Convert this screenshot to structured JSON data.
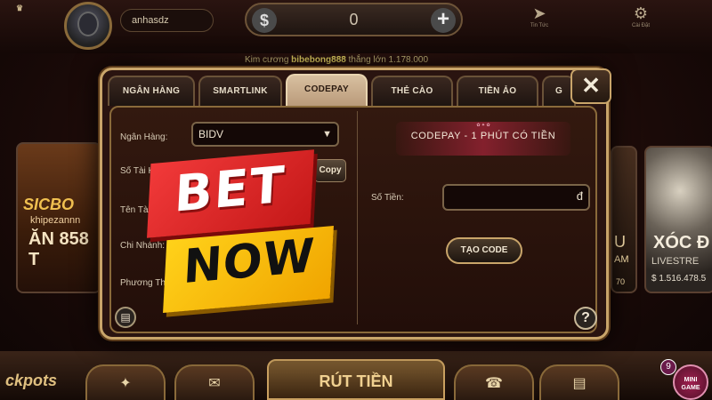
{
  "header": {
    "username": "anhasdz",
    "balance": "0",
    "currency_icon": "dollar-icon",
    "add_icon": "plus-icon",
    "right_icons": [
      {
        "name": "send-icon",
        "label": "Tin Tức"
      },
      {
        "name": "gear-icon",
        "label": "Cài Đặt"
      }
    ]
  },
  "ticker": {
    "prefix": "Kim cương",
    "name": "bibebong888",
    "suffix": "thắng lớn 1.178.000"
  },
  "dialog": {
    "tabs": [
      {
        "label": "NGÂN HÀNG",
        "active": false
      },
      {
        "label": "SMARTLINK",
        "active": false
      },
      {
        "label": "CODEPAY",
        "active": true
      },
      {
        "label": "THẺ CÀO",
        "active": false
      },
      {
        "label": "TIỀN ẢO",
        "active": false
      },
      {
        "label": "G",
        "active": false
      }
    ],
    "close_label": "✕",
    "form": {
      "bank_label": "Ngân Hàng:",
      "bank_value": "BIDV",
      "account_label": "Số Tài Kh",
      "copy_label": "Copy",
      "name_label": "Tên Tài",
      "branch_label": "Chi Nhánh:",
      "method_label": "Phương Thứ"
    },
    "banner": {
      "title": "CODEPAY - 1 PHÚT CÓ TIỀN"
    },
    "amount_label": "Số Tiền:",
    "amount_unit": "đ",
    "create_button": "TẠO CODE",
    "help_label": "?"
  },
  "overlay": {
    "bet": "BET",
    "now": "NOW",
    "bet_color": "#e82a2a",
    "now_color": "#ffc400"
  },
  "background": {
    "left_tile": {
      "title": "SICBO",
      "player": "khipezannn",
      "amount": "ĂN 858 T"
    },
    "right_tile_partial": "U",
    "right_tile_partial2": "AM",
    "right_tile_partial3": "70",
    "right_tile": {
      "title": "XÓC Đ",
      "subtitle": "LIVESTRE",
      "amount": "$ 1.516.478.5"
    }
  },
  "footer": {
    "jackpot_label": "ckpots",
    "withdraw_label": "RÚT TIỀN",
    "mini_game_label": "MINI GAME",
    "mini_game_badge": "9"
  },
  "colors": {
    "accent_gold": "#c9a56a",
    "dialog_bg": "#2a1410",
    "active_tab": "#d8c0a0"
  }
}
